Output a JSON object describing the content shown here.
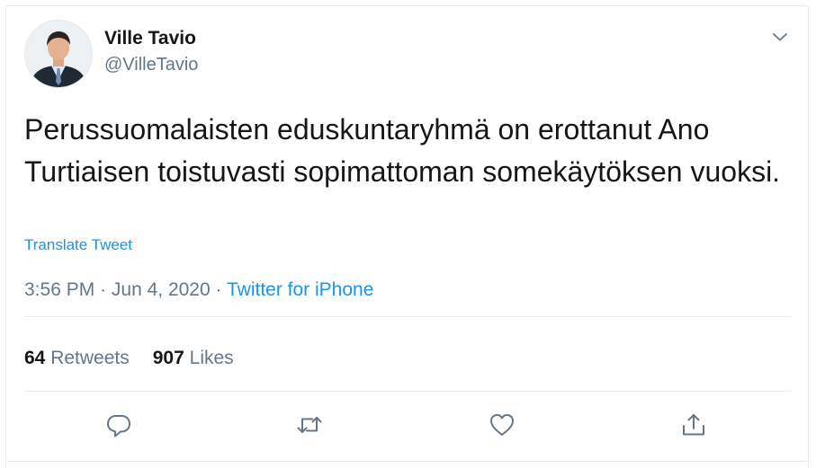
{
  "tweet": {
    "author": {
      "display_name": "Ville Tavio",
      "handle": "@VilleTavio",
      "avatar_icon": "profile-photo"
    },
    "text": "Perussuomalaisten eduskuntaryhmä on erottanut Ano Turtiaisen toistuvasti sopimattoman somekäytöksen vuoksi.",
    "translate_label": "Translate Tweet",
    "time": "3:56 PM",
    "date": "Jun 4, 2020",
    "dot": "·",
    "source": "Twitter for iPhone",
    "stats": {
      "retweets_count": "64",
      "retweets_label": "Retweets",
      "likes_count": "907",
      "likes_label": "Likes"
    },
    "actions": {
      "reply_icon": "reply-icon",
      "retweet_icon": "retweet-icon",
      "like_icon": "heart-icon",
      "share_icon": "share-icon",
      "more_icon": "chevron-down-icon"
    }
  },
  "colors": {
    "link": "#1b95e0",
    "secondary_text": "#657786",
    "primary_text": "#14171a",
    "divider": "#e6ecf0"
  }
}
